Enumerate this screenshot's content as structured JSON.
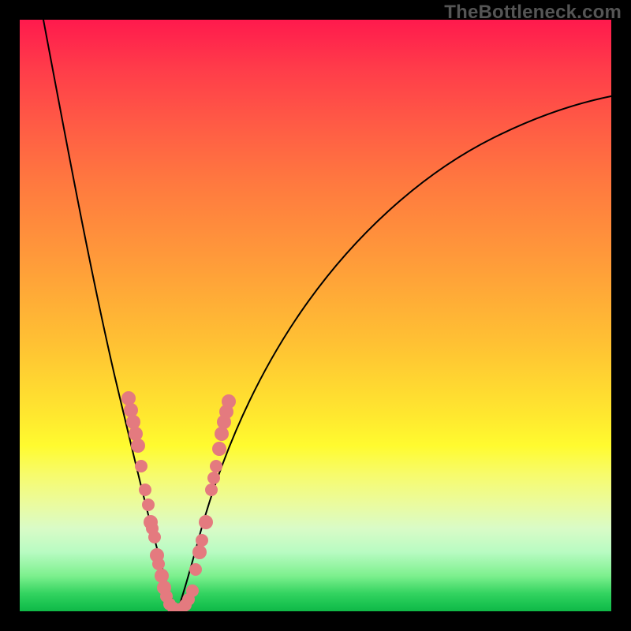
{
  "watermark": "TheBottleneck.com",
  "chart_data": {
    "type": "line",
    "title": "",
    "xlabel": "",
    "ylabel": "",
    "xlim": [
      0,
      100
    ],
    "ylim": [
      0,
      100
    ],
    "grid": false,
    "legend": false,
    "series": [
      {
        "name": "left-descending-curve",
        "x": [
          4,
          6,
          8,
          10,
          12,
          14,
          16,
          18,
          20,
          22,
          24,
          26
        ],
        "y": [
          100,
          82,
          66,
          52,
          40,
          30,
          22,
          15,
          10,
          6,
          3,
          0
        ]
      },
      {
        "name": "right-ascending-curve",
        "x": [
          26,
          28,
          30,
          34,
          38,
          44,
          50,
          58,
          66,
          74,
          82,
          90,
          100
        ],
        "y": [
          0,
          6,
          12,
          22,
          32,
          43,
          52,
          61,
          68,
          74,
          79,
          83,
          87
        ]
      }
    ],
    "markers": {
      "name": "salmon-dots",
      "color": "#e47a7f",
      "points": [
        {
          "x": 18.4,
          "y": 36.0
        },
        {
          "x": 18.8,
          "y": 34.0
        },
        {
          "x": 19.2,
          "y": 32.0
        },
        {
          "x": 19.6,
          "y": 30.0
        },
        {
          "x": 20.0,
          "y": 28.0
        },
        {
          "x": 20.6,
          "y": 24.5
        },
        {
          "x": 21.2,
          "y": 20.5
        },
        {
          "x": 21.7,
          "y": 18.0
        },
        {
          "x": 22.2,
          "y": 15.0
        },
        {
          "x": 22.4,
          "y": 14.0
        },
        {
          "x": 22.8,
          "y": 12.5
        },
        {
          "x": 23.2,
          "y": 9.5
        },
        {
          "x": 23.5,
          "y": 8.0
        },
        {
          "x": 24.0,
          "y": 6.0
        },
        {
          "x": 24.4,
          "y": 4.0
        },
        {
          "x": 24.8,
          "y": 2.5
        },
        {
          "x": 25.4,
          "y": 1.2
        },
        {
          "x": 26.0,
          "y": 0.6
        },
        {
          "x": 26.6,
          "y": 0.0
        },
        {
          "x": 27.4,
          "y": 0.4
        },
        {
          "x": 28.0,
          "y": 1.0
        },
        {
          "x": 28.6,
          "y": 2.0
        },
        {
          "x": 29.2,
          "y": 3.5
        },
        {
          "x": 29.8,
          "y": 7.0
        },
        {
          "x": 30.4,
          "y": 10.0
        },
        {
          "x": 30.8,
          "y": 12.0
        },
        {
          "x": 31.4,
          "y": 15.0
        },
        {
          "x": 32.4,
          "y": 20.5
        },
        {
          "x": 32.8,
          "y": 22.5
        },
        {
          "x": 33.2,
          "y": 24.5
        },
        {
          "x": 33.8,
          "y": 27.5
        },
        {
          "x": 34.2,
          "y": 30.0
        },
        {
          "x": 34.6,
          "y": 32.0
        },
        {
          "x": 35.0,
          "y": 33.8
        },
        {
          "x": 35.4,
          "y": 35.5
        }
      ]
    },
    "background_gradient": {
      "direction": "vertical",
      "stops": [
        {
          "pos": 0,
          "color": "#ff1a4d"
        },
        {
          "pos": 50,
          "color": "#ffb636"
        },
        {
          "pos": 72,
          "color": "#fffb2f"
        },
        {
          "pos": 100,
          "color": "#10b847"
        }
      ]
    }
  }
}
